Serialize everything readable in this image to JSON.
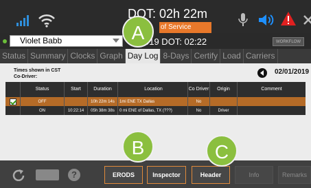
{
  "status_bar": {
    "dot_text": "DOT: 02h 22m",
    "out_of_service": "of Service",
    "icons": [
      "signal-icon",
      "wifi-icon",
      "microphone-icon",
      "speaker-icon",
      "warning-icon",
      "close-icon"
    ],
    "colors": {
      "orange": "#e8782a",
      "warning": "#e02020",
      "speaker": "#1e90ff"
    }
  },
  "driver": {
    "name": "Violet Babb",
    "date_text": "019  DOT: 02:22",
    "workflow": "WORKFLOW"
  },
  "tabs": [
    "Status",
    "Summary",
    "Clocks",
    "Graph",
    "Day Log",
    "8-Days",
    "Certify",
    "Load",
    "Carriers"
  ],
  "active_tab": "Day Log",
  "info": {
    "line1": "Times shown in CST",
    "line2": "Co-Driver:",
    "date": "02/01/2019"
  },
  "table": {
    "headers": [
      "",
      "Status",
      "Start",
      "Duration",
      "Location",
      "Co Driver",
      "Origin",
      "Comment"
    ],
    "rows": [
      {
        "status": "OFF",
        "start": "",
        "duration": "10h 22m 14s",
        "location": "1mi ENE TX Dallas",
        "co_driver": "No",
        "origin": "",
        "comment": "",
        "selected": true
      },
      {
        "status": "ON",
        "start": "10:22:14",
        "duration": "05h 38m 38s",
        "location": "0 mi ENE of Dallas, TX (???)",
        "co_driver": "No",
        "origin": "Driver",
        "comment": "",
        "selected": false
      }
    ]
  },
  "bottom_bar": {
    "help_label": "?",
    "buttons": [
      {
        "label": "ERODS",
        "enabled": true
      },
      {
        "label": "Inspector",
        "enabled": true
      },
      {
        "label": "Header",
        "enabled": true
      },
      {
        "label": "Info",
        "enabled": false
      },
      {
        "label": "Remarks",
        "enabled": false
      }
    ]
  },
  "callouts": [
    "A",
    "B",
    "C"
  ]
}
